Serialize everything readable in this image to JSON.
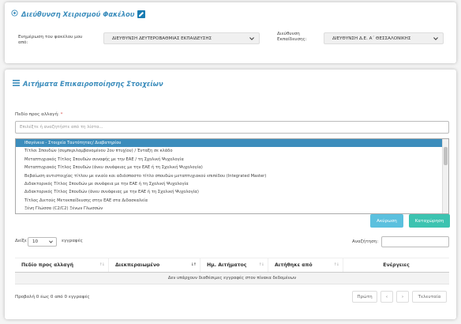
{
  "section1": {
    "title": "Διεύθυνση Χειρισμού Φακέλου",
    "update_label": "Ενημέρωση του φακέλου μου από:",
    "update_value": "ΔΙΕΥΘΥΝΣΗ ΔΕΥΤΕΡΟΒΑΘΜΙΑΣ ΕΚΠΑΙΔΕΥΣΗΣ",
    "edu_label": "Διεύθυνση Εκπαίδευσης:",
    "edu_value": "ΔΙΕΥΘΥΝΣΗ Δ.Ε. Α΄ ΘΕΣΣΑΛΟΝΙΚΗΣ"
  },
  "section2": {
    "title": "Αιτήματα Επικαιροποίησης Στοιχείων",
    "field_label": "Πεδίο προς αλλαγή:",
    "field_placeholder": "Επιλέξτε ή αναζητήστε από τη λίστα...",
    "options": [
      "Ιθαγένεια - Στοιχεία Ταυτότητας/ Διαβατηρίου",
      "Τίτλοι Σπουδών (συμπεριλαμβανομένου 2ου πτυχίου) / Ένταξη σε κλάδο",
      "Μεταπτυχιακός Τίτλος Σπουδών συναφής με την ΕΑΕ / τη Σχολική Ψυχολογία",
      "Μεταπτυχιακός Τίτλος Σπουδών (άνευ συνάφειας με την ΕΑΕ ή τη Σχολική Ψυχολογία)",
      "Βεβαίωση αντιστοιχίας τίτλου με ενιαίο και αδιάσπαστο τίτλο σπουδών μεταπτυχιακού επιπέδου (Integrated Master)",
      "Διδακτορικός Τίτλος Σπουδών με συνάφεια με την ΕΑΕ ή τη Σχολική Ψυχολογία",
      "Διδακτορικός Τίτλος Σπουδών (άνευ συνάφειας με την ΕΑΕ ή τη Σχολική Ψυχολογία)",
      "Τίτλος Διετούς Μετεκπαίδευσης στην ΕΑΕ στα Διδασκαλεία",
      "Ξένη Γλώσσα (C2/C2) Ξένων Γλωσσών"
    ],
    "cancel_label": "Ακύρωση",
    "submit_label": "Καταχώρηση",
    "show_label": "Δείξε",
    "page_length": "10",
    "entries_label": "εγγραφές",
    "search_label": "Αναζήτηση:",
    "columns": [
      "Πεδίο προς αλλαγή",
      "Διεκπεραιωμένο",
      "Ημ. Αιτήματος",
      "Αιτήθηκε από",
      "Ενέργειες"
    ],
    "empty_message": "Δεν υπάρχουν διαθέσιμες εγγραφές στον πίνακα δεδομένων",
    "info": "Προβολή 0 έως 0 από 0 εγγραφές",
    "pager": {
      "first": "Πρώτη",
      "prev": "‹",
      "next": "›",
      "last": "Τελευταία"
    }
  }
}
